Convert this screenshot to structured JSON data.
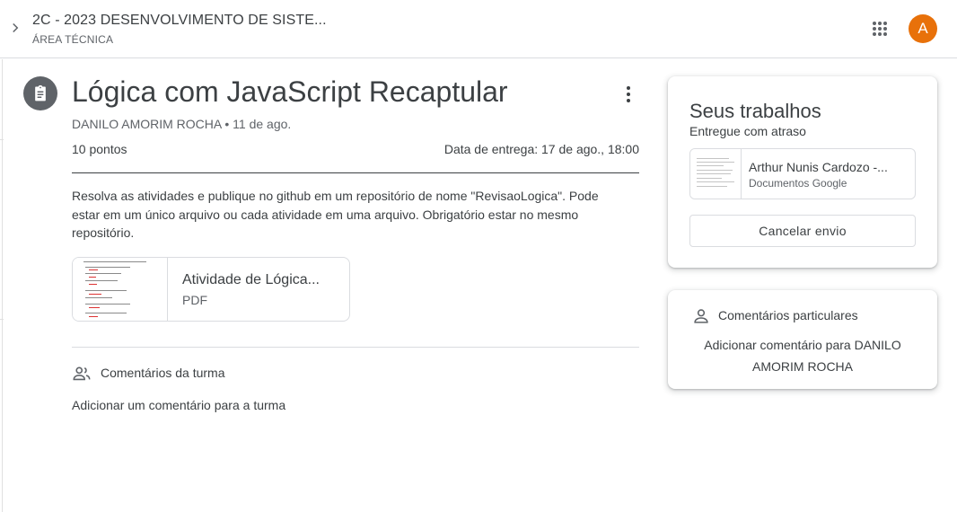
{
  "header": {
    "course_title": "2C - 2023 DESENVOLVIMENTO DE SISTE...",
    "course_subtitle": "ÁREA TÉCNICA",
    "avatar_letter": "A",
    "avatar_color": "#e8710a",
    "icons": [
      "chevron-right-icon",
      "apps-grid-icon"
    ]
  },
  "assignment": {
    "title": "Lógica com JavaScript Recaptular",
    "meta": "DANILO AMORIM ROCHA • 11 de ago.",
    "points": "10 pontos",
    "due": "Data de entrega: 17 de ago., 18:00",
    "description": "Resolva as atividades e publique no github em um repositório de nome \"RevisaoLogica\". Pode estar em um único arquivo ou cada atividade em uma arquivo. Obrigatório estar no mesmo repositório.",
    "attachment": {
      "name": "Atividade de Lógica...",
      "type": "PDF"
    }
  },
  "class_comments": {
    "label": "Comentários da turma",
    "add": "Adicionar um comentário para a turma"
  },
  "your_work": {
    "title": "Seus trabalhos",
    "status": "Entregue com atraso",
    "file": {
      "name": "Arthur Nunis Cardozo -...",
      "type": "Documentos Google"
    },
    "cancel_label": "Cancelar envio"
  },
  "private_comments": {
    "label": "Comentários particulares",
    "add": "Adicionar comentário para DANILO AMORIM ROCHA"
  }
}
